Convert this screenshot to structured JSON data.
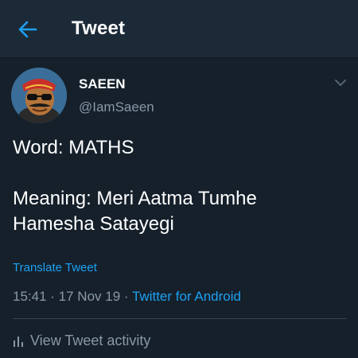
{
  "header": {
    "title": "Tweet",
    "back_icon": "arrow-left-icon",
    "accent": "#1da1f2",
    "bg": "#1c2a38"
  },
  "tweet": {
    "author": {
      "name": "SAEEN",
      "handle": "@IamSaeen",
      "avatar_icon": "cartoon-avatar"
    },
    "text": {
      "line1": "Word: MATHS",
      "line2": "Meaning: Meri Aatma Tumhe",
      "line3": "Hamesha Satayegi"
    },
    "translate_label": "Translate Tweet",
    "time": "15:41",
    "date": "17 Nov 19",
    "separator": "·",
    "source": "Twitter for Android",
    "activity_label": "View Tweet activity",
    "activity_icon": "bar-chart-icon",
    "more_icon": "chevron-down-icon"
  },
  "colors": {
    "background": "#15202b",
    "text_primary": "#ffffff",
    "text_secondary": "#8899a6",
    "link": "#1da1f2",
    "divider": "#38444d"
  }
}
